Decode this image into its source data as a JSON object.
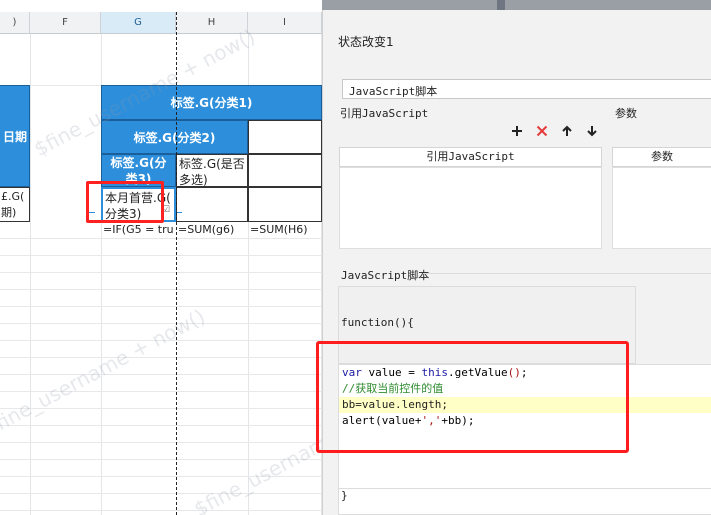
{
  "sheet": {
    "columns": [
      {
        "label": ")",
        "selected": false
      },
      {
        "label": "F",
        "selected": false
      },
      {
        "label": "G",
        "selected": true
      },
      {
        "label": "H",
        "selected": false
      },
      {
        "label": "I",
        "selected": false
      }
    ],
    "cells": {
      "left_header_fragment": "日期",
      "left_value_fragment_1": "£.G(",
      "left_value_fragment_2": "期)",
      "g_category1": "标签.G(分类1)",
      "g_category2": "标签.G(分类2)",
      "g_category3_line1": "标签.G(分",
      "g_category3_line2": "类3)",
      "h_selected_line1": "标签.G(是否",
      "h_selected_line2": "多选)",
      "g_value_line1": "本月首营.G(",
      "g_value_line2": "分类3)",
      "formula_g": "=IF(G5 = tru",
      "formula_h": "=SUM(g6)",
      "formula_i": "=SUM(H6)"
    },
    "watermark": "$fine_username + now()"
  },
  "panel": {
    "title": "状态改变1",
    "script_type_value": "JavaScript脚本",
    "ref_js_label": "引用JavaScript",
    "params_label": "参数",
    "toolbar_icons": [
      "plus-icon",
      "cross-icon",
      "arrow-up-icon",
      "arrow-down-icon"
    ],
    "table_ref_header": "引用JavaScript",
    "table_params_header": "参数",
    "script_section_label": "JavaScript脚本",
    "function_open": "function(){",
    "code": {
      "line1_kw1": "var",
      "line1_rest1": " value = ",
      "line1_kw2": "this",
      "line1_rest2": ".getValue",
      "line1_paren": "()",
      "line1_end": ";",
      "line2_comment": "//获取当前控件的值",
      "line3": "bb=value.length;",
      "line4_a": "alert(value+",
      "line4_str": "','",
      "line4_b": "+bb);"
    },
    "function_close": "}"
  },
  "colors": {
    "header_blue": "#2d8fdb",
    "annotation_red": "#ff2020",
    "keyword_blue": "#1a1aa6",
    "comment_green": "#2e8b2e",
    "highlight_yellow": "#ffffc6"
  }
}
